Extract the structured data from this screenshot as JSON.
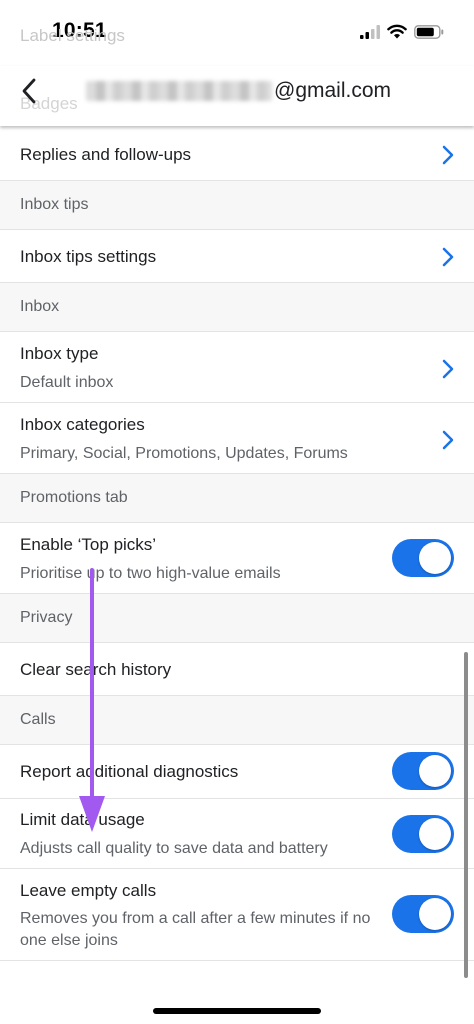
{
  "status_bar": {
    "time": "10:51"
  },
  "behind_header": {
    "line_1": "Label settings",
    "line_2": "Badges"
  },
  "header": {
    "account_suffix": "@gmail.com"
  },
  "rows": {
    "replies_follow_ups": "Replies and follow-ups",
    "inbox_tips_section": "Inbox tips",
    "inbox_tips_settings": "Inbox tips settings",
    "inbox_section": "Inbox",
    "inbox_type": {
      "title": "Inbox type",
      "value": "Default inbox"
    },
    "inbox_categories": {
      "title": "Inbox categories",
      "value": "Primary, Social, Promotions, Updates, Forums"
    },
    "promotions_section": "Promotions tab",
    "top_picks": {
      "title": "Enable ‘Top picks’",
      "subtitle": "Prioritise up to two high-value emails",
      "enabled": true
    },
    "privacy_section": "Privacy",
    "clear_search_history": "Clear search history",
    "calls_section": "Calls",
    "report_diagnostics": {
      "title": "Report additional diagnostics",
      "enabled": true
    },
    "limit_data_usage": {
      "title": "Limit data usage",
      "subtitle": "Adjusts call quality to save data and battery",
      "enabled": true
    },
    "leave_empty_calls": {
      "title": "Leave empty calls",
      "subtitle": "Removes you from a call after a few minutes if no one else joins",
      "enabled": true
    }
  },
  "colors": {
    "toggle_on": "#1a73e8",
    "chevron": "#1a73e8",
    "annotation_arrow": "#a259f0",
    "section_bg": "#f7f7f7"
  },
  "icons": [
    "back-arrow",
    "chevron-right",
    "signal-bars",
    "wifi",
    "battery"
  ]
}
